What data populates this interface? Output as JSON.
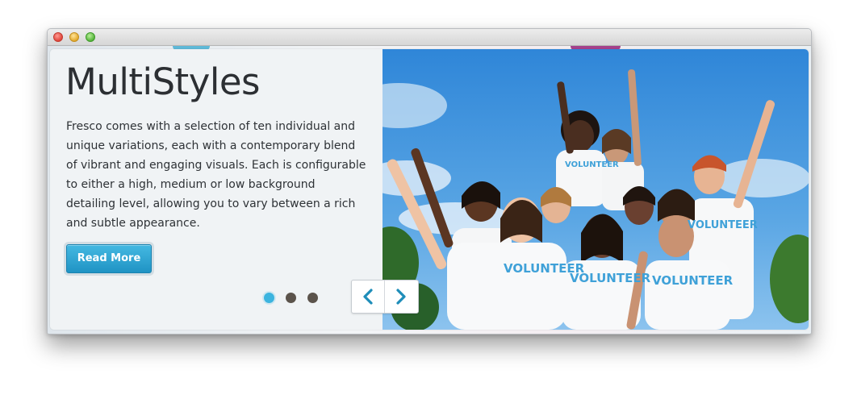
{
  "slider": {
    "title": "MultiStyles",
    "description": "Fresco comes with a selection of ten individual and unique variations, each with a contemporary blend of vibrant and engaging visuals. Each is configurable to either a high, medium or low background detailing level, allowing you to vary between a rich and subtle appearance.",
    "button_label": "Read More",
    "pagination": {
      "total": 3,
      "active_index": 0
    },
    "shirt_text": "VOLUNTEER",
    "icons": {
      "prev": "chevron-left-icon",
      "next": "chevron-right-icon"
    }
  },
  "colors": {
    "accent": "#3cb4df",
    "button": "#26a0d0",
    "dot_inactive": "#5b534b",
    "title": "#2c2f33"
  }
}
